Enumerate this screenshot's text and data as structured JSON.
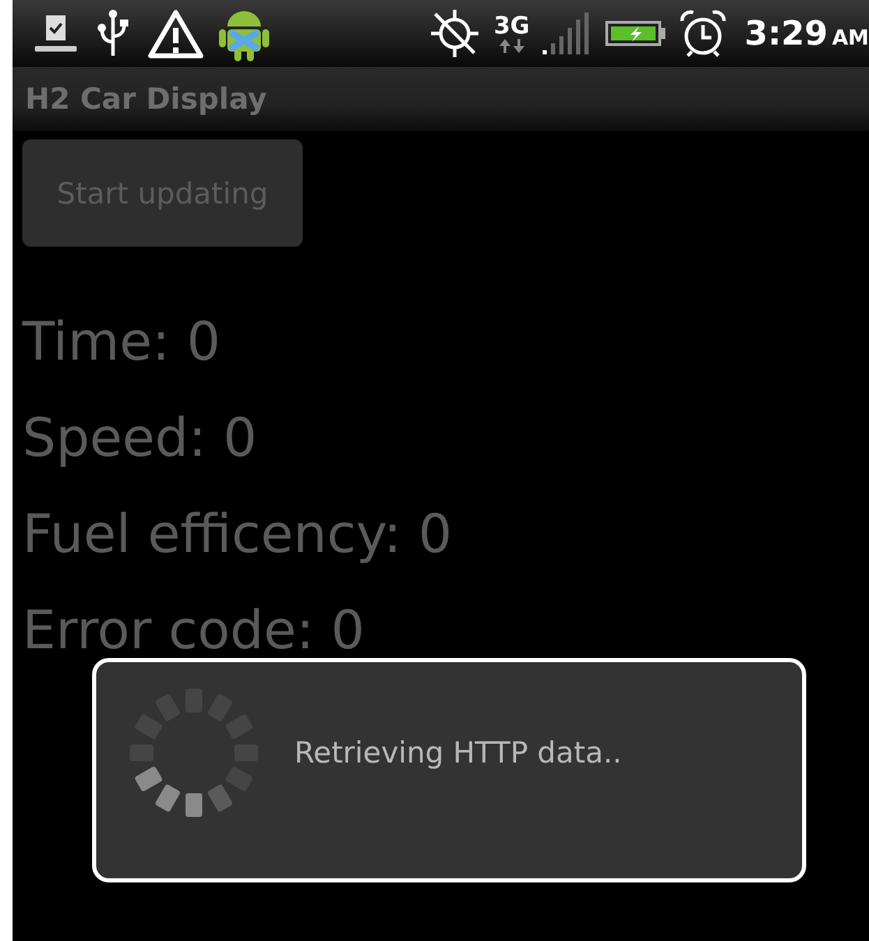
{
  "status_bar": {
    "network": "3G",
    "time": "3:29",
    "meridiem": "AM"
  },
  "title_bar": {
    "title": "H2 Car Display"
  },
  "button": {
    "label": "Start updating"
  },
  "readings": [
    {
      "text": "Time: 0"
    },
    {
      "text": "Speed: 0"
    },
    {
      "text": "Fuel efficency: 0"
    },
    {
      "text": "Error code: 0"
    }
  ],
  "dialog": {
    "message": "Retrieving HTTP data.."
  }
}
